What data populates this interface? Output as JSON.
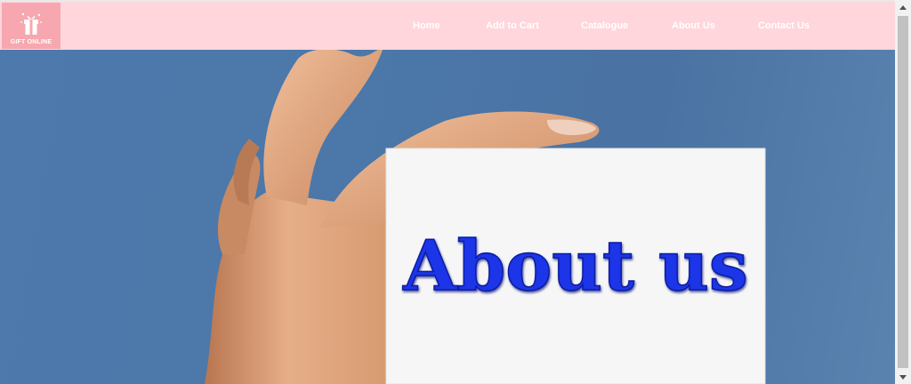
{
  "logo": {
    "text": "GIFT ONLINE",
    "icon": "gift-icon"
  },
  "nav": {
    "home": "Home",
    "add_to_cart": "Add to Cart",
    "catalogue": "Catalogue",
    "about_us": "About Us",
    "contact_us": "Contact Us"
  },
  "hero": {
    "card_text": "About us"
  },
  "colors": {
    "navbar": "#ffd6dc",
    "logo_bg": "#f7a7b0",
    "sky": "#4b77a9",
    "card_text": "#1a35e8"
  }
}
